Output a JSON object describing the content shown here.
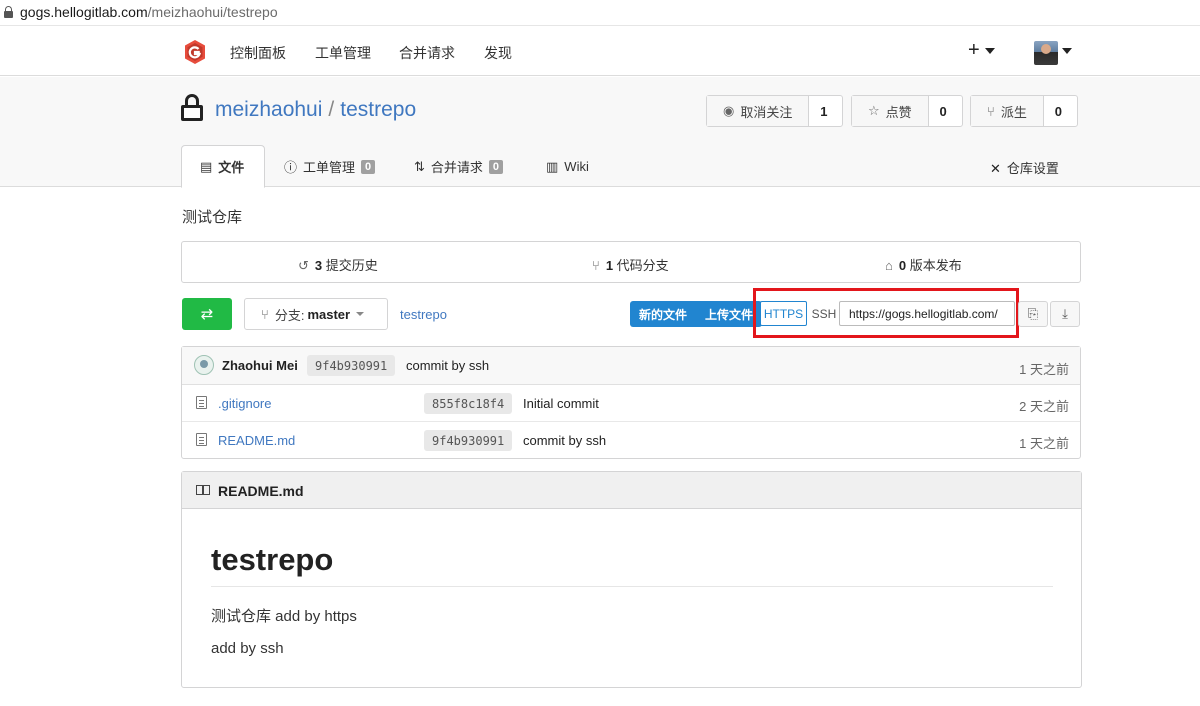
{
  "browser": {
    "url_host": "gogs.hellogitlab.com",
    "url_path": "/meizhaohui/testrepo"
  },
  "topnav": {
    "items": [
      "控制面板",
      "工单管理",
      "合并请求",
      "发现"
    ],
    "plus": "+"
  },
  "repo": {
    "owner": "meizhaohui",
    "separator": "/",
    "name": "testrepo",
    "watch": {
      "label": "取消关注",
      "count": "1"
    },
    "star": {
      "label": "点赞",
      "count": "0"
    },
    "fork": {
      "label": "派生",
      "count": "0"
    }
  },
  "tabs": [
    {
      "label": "文件"
    },
    {
      "label": "工单管理",
      "badge": "0"
    },
    {
      "label": "合并请求",
      "badge": "0"
    },
    {
      "label": "Wiki"
    }
  ],
  "settings_label": "仓库设置",
  "description": "测试仓库",
  "stats": {
    "commits": {
      "count": "3",
      "label": "提交历史"
    },
    "branches": {
      "count": "1",
      "label": "代码分支"
    },
    "releases": {
      "count": "0",
      "label": "版本发布"
    }
  },
  "toolbar": {
    "branch_prefix": "分支:",
    "branch": "master",
    "breadcrumb": "testrepo",
    "new_file": "新的文件",
    "upload_file": "上传文件",
    "https": "HTTPS",
    "ssh": "SSH",
    "clone_url": "https://gogs.hellogitlab.com/"
  },
  "latest_commit": {
    "author": "Zhaohui Mei",
    "sha": "9f4b930991",
    "message": "commit by ssh",
    "age": "1 天之前"
  },
  "files": [
    {
      "name": ".gitignore",
      "sha": "855f8c18f4",
      "message": "Initial commit",
      "age": "2 天之前"
    },
    {
      "name": "README.md",
      "sha": "9f4b930991",
      "message": "commit by ssh",
      "age": "1 天之前"
    }
  ],
  "readme": {
    "filename": "README.md",
    "heading": "testrepo",
    "paragraphs": [
      "测试仓库 add by https",
      "add by ssh"
    ]
  },
  "colors": {
    "link": "#4078c0",
    "green": "#21ba45",
    "blue": "#2185d0",
    "highlight": "#e3161b"
  }
}
